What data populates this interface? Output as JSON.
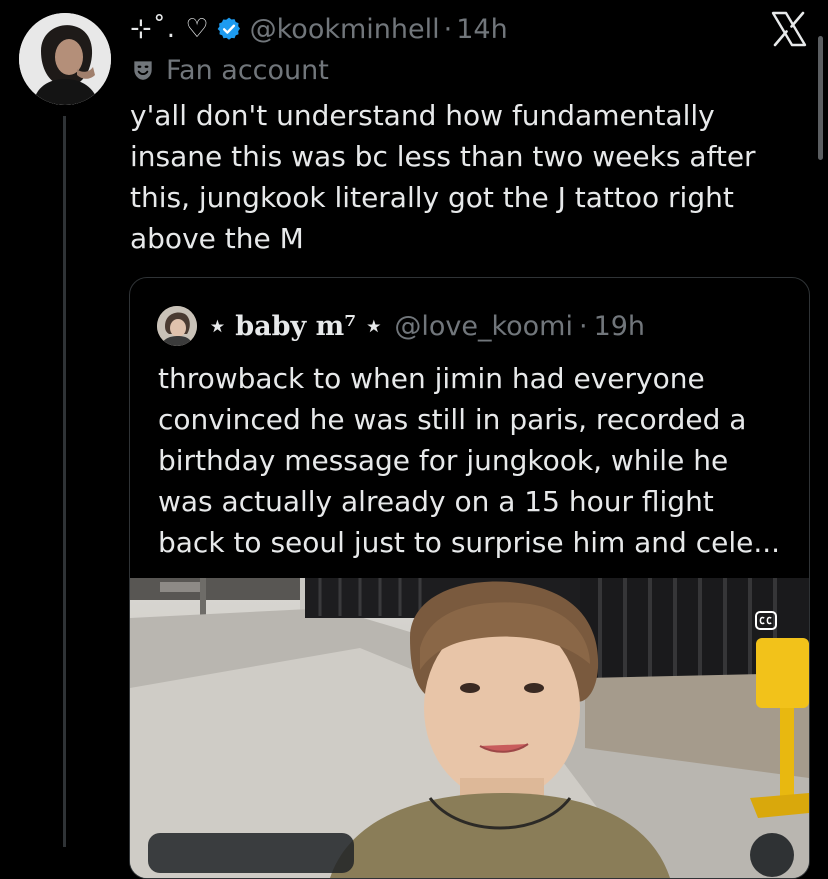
{
  "author": {
    "display_name": "⊹˚. ♡",
    "handle": "@kookminhell",
    "separator": "·",
    "time": "14h",
    "label": "Fan account"
  },
  "tweet": {
    "text": "y'all don't understand how fundamentally insane this was bc less than two weeks after this, jungkook literally got the J tattoo right above the M"
  },
  "quoted": {
    "display_name": "⋆ baby m⁷ ⋆",
    "handle": "@love_koomi",
    "separator": "·",
    "time": "19h",
    "text": "throwback to when jimin had everyone convinced he was still in paris, recorded a birthday message for jungkook, while he was actually already on a 15 hour flight back to seoul just to surprise him and cele..."
  },
  "icons": {
    "brand": "x-logo-icon",
    "verified": "verified-badge-icon",
    "label": "theater-masks-icon",
    "captions": "closed-captions-icon"
  },
  "colors": {
    "background": "#000000",
    "text": "#e7e9ea",
    "muted": "#71767b",
    "border": "#2f3336",
    "verified": "#1d9bf0"
  }
}
